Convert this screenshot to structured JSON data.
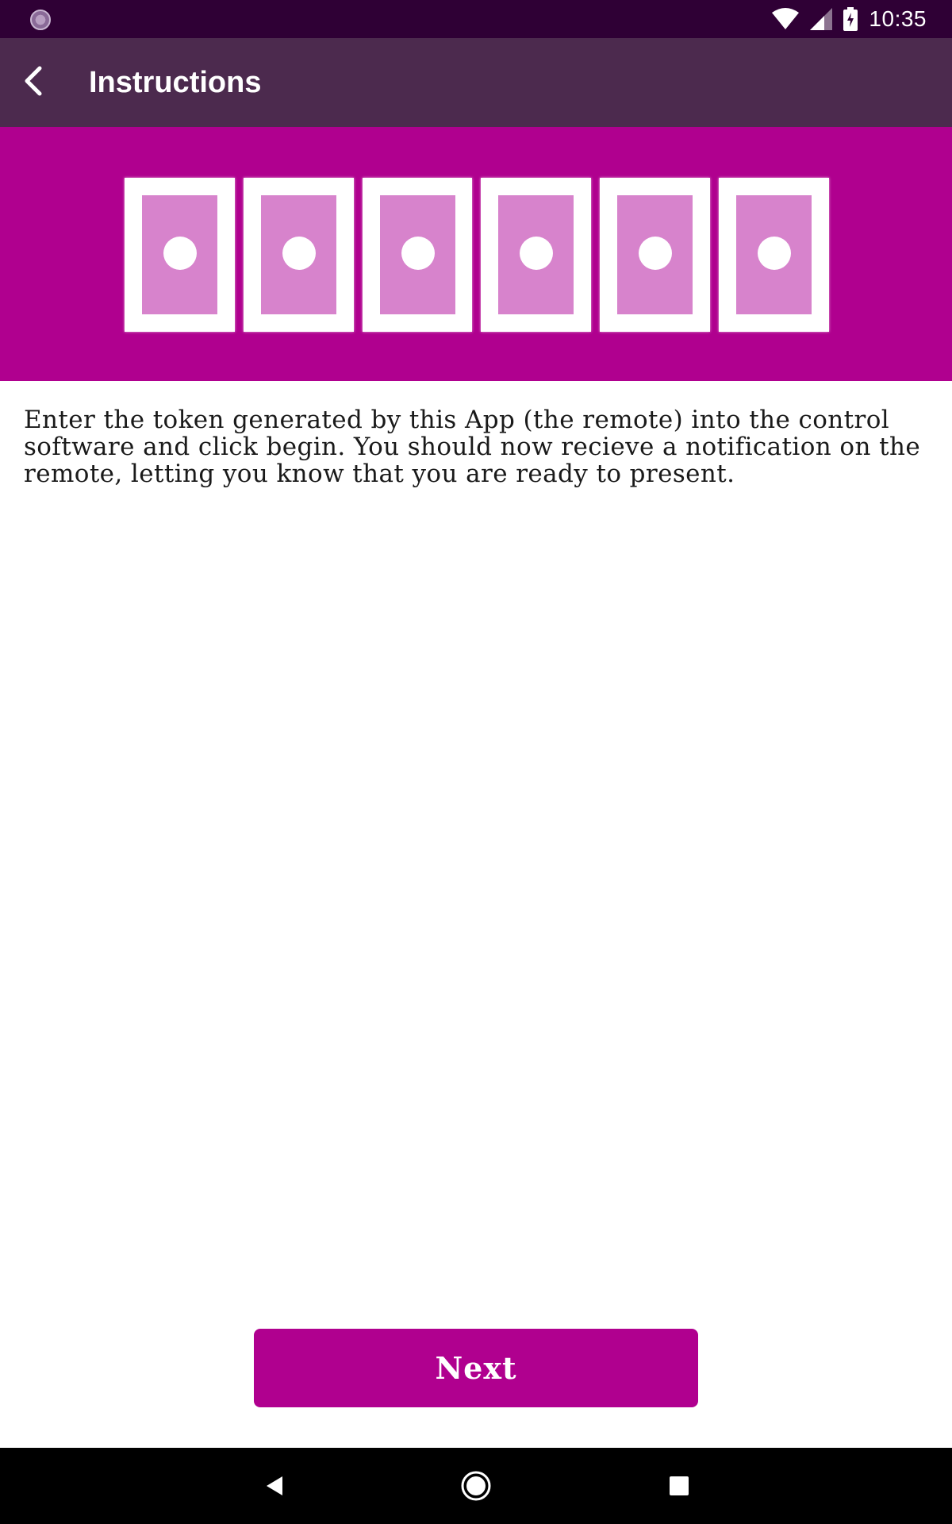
{
  "status_bar": {
    "time": "10:35",
    "icons": [
      "notification-icon",
      "wifi-icon",
      "signal-icon",
      "battery-charging-icon"
    ]
  },
  "app_bar": {
    "title": "Instructions",
    "back_icon": "chevron-left-icon"
  },
  "hero": {
    "background_color": "#b0008f",
    "token_count": 6,
    "token_box_color": "#ffffff",
    "token_inner_color": "#d783cc"
  },
  "content": {
    "instructions": "Enter the token generated by this App (the remote) into the control software and click begin. You should now recieve a notification on the remote, letting you know that you are ready to present."
  },
  "actions": {
    "next_label": "Next",
    "accent_color": "#b0008f"
  },
  "nav_bar": {
    "icons": [
      "nav-back-icon",
      "nav-home-icon",
      "nav-recents-icon"
    ]
  }
}
